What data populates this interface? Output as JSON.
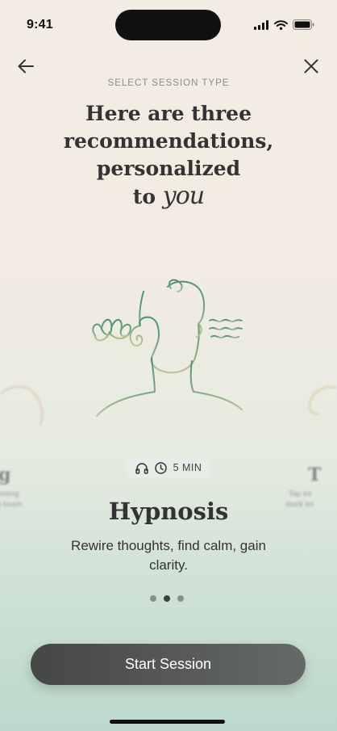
{
  "status_bar": {
    "time": "9:41"
  },
  "header": {
    "kicker": "SELECT SESSION TYPE",
    "headline_lines": [
      "Here are three",
      "recommendations,",
      "personalized"
    ],
    "headline_to": "to",
    "headline_you": "you"
  },
  "carousel": {
    "prev_card": {
      "title": "g",
      "desc_lines": [
        "essing",
        "h touch"
      ]
    },
    "next_card": {
      "title": "T",
      "desc_lines": [
        "Tap int",
        "stuck en"
      ]
    },
    "current": {
      "duration": "5 MIN",
      "icons": [
        "headphones-icon",
        "clock-icon"
      ],
      "title": "Hypnosis",
      "description": "Rewire thoughts, find calm, gain clarity."
    },
    "page_count": 3,
    "active_page": 2
  },
  "cta": {
    "label": "Start Session"
  },
  "colors": {
    "accent_green": "#5f9a7e",
    "cta_dark": "#4a4c4a"
  }
}
